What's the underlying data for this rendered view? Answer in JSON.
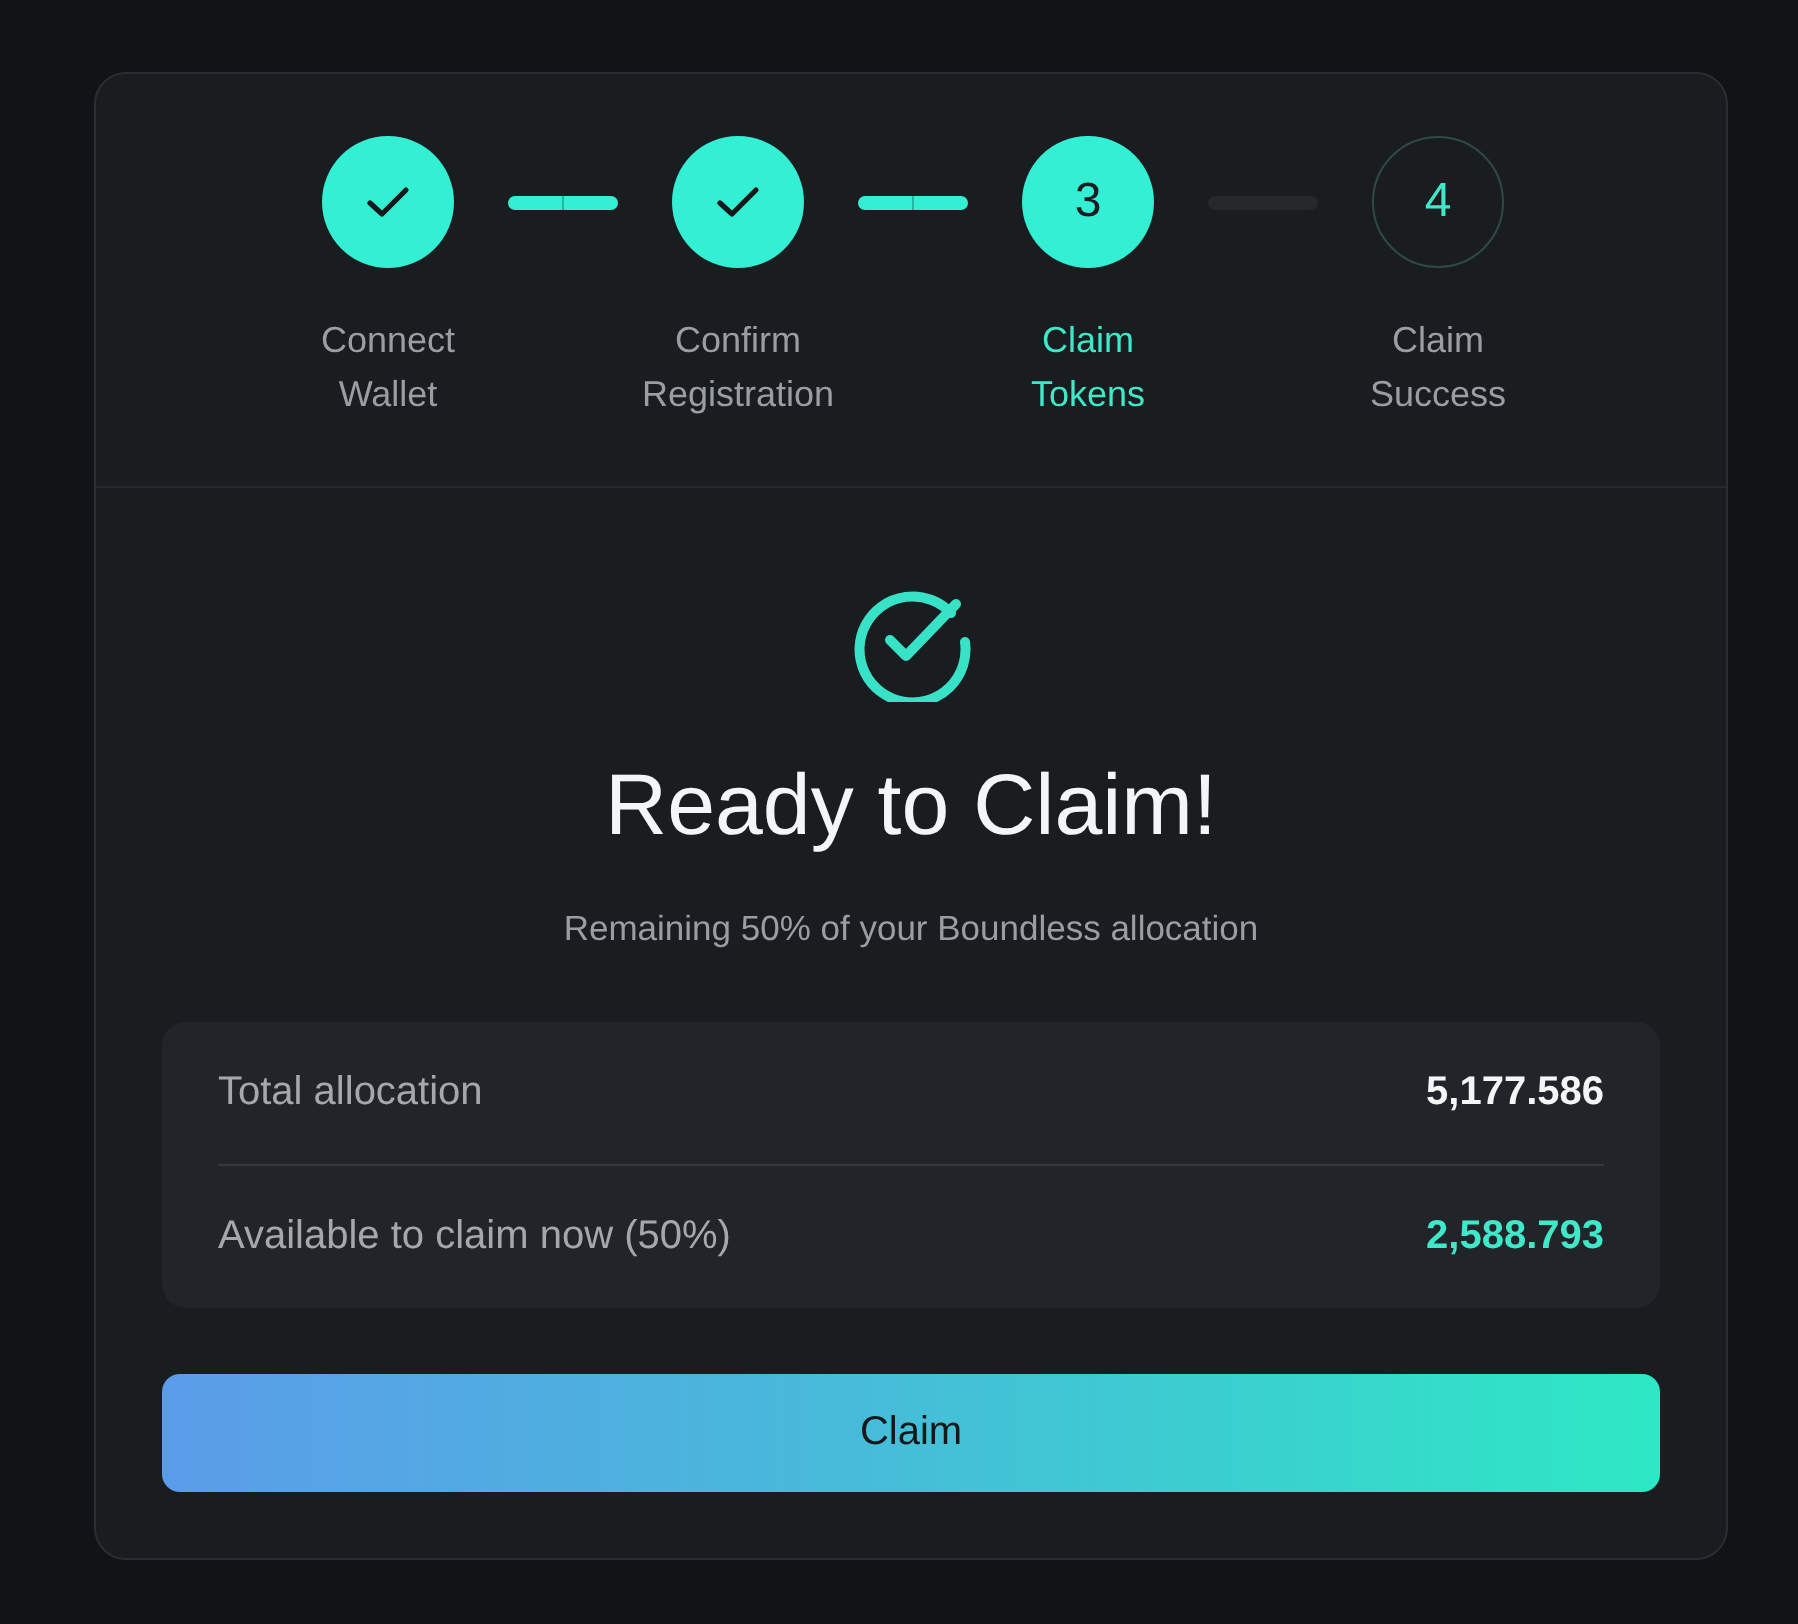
{
  "steps": [
    {
      "label": "Connect Wallet",
      "completed": true,
      "selected": false
    },
    {
      "label": "Confirm Registration",
      "completed": true,
      "selected": false
    },
    {
      "label": "Claim Tokens",
      "number": "3",
      "completed": false,
      "selected": true
    },
    {
      "label": "Claim Success",
      "number": "4",
      "completed": false,
      "selected": false
    }
  ],
  "title": "Ready to Claim!",
  "subtitle": "Remaining 50% of your Boundless allocation",
  "summary": {
    "rows": [
      {
        "label": "Total allocation",
        "value": "5,177.586",
        "highlighted": false
      },
      {
        "label": "Available to claim now (50%)",
        "value": "2,588.793",
        "highlighted": true
      }
    ]
  },
  "button": {
    "label": "Claim"
  }
}
